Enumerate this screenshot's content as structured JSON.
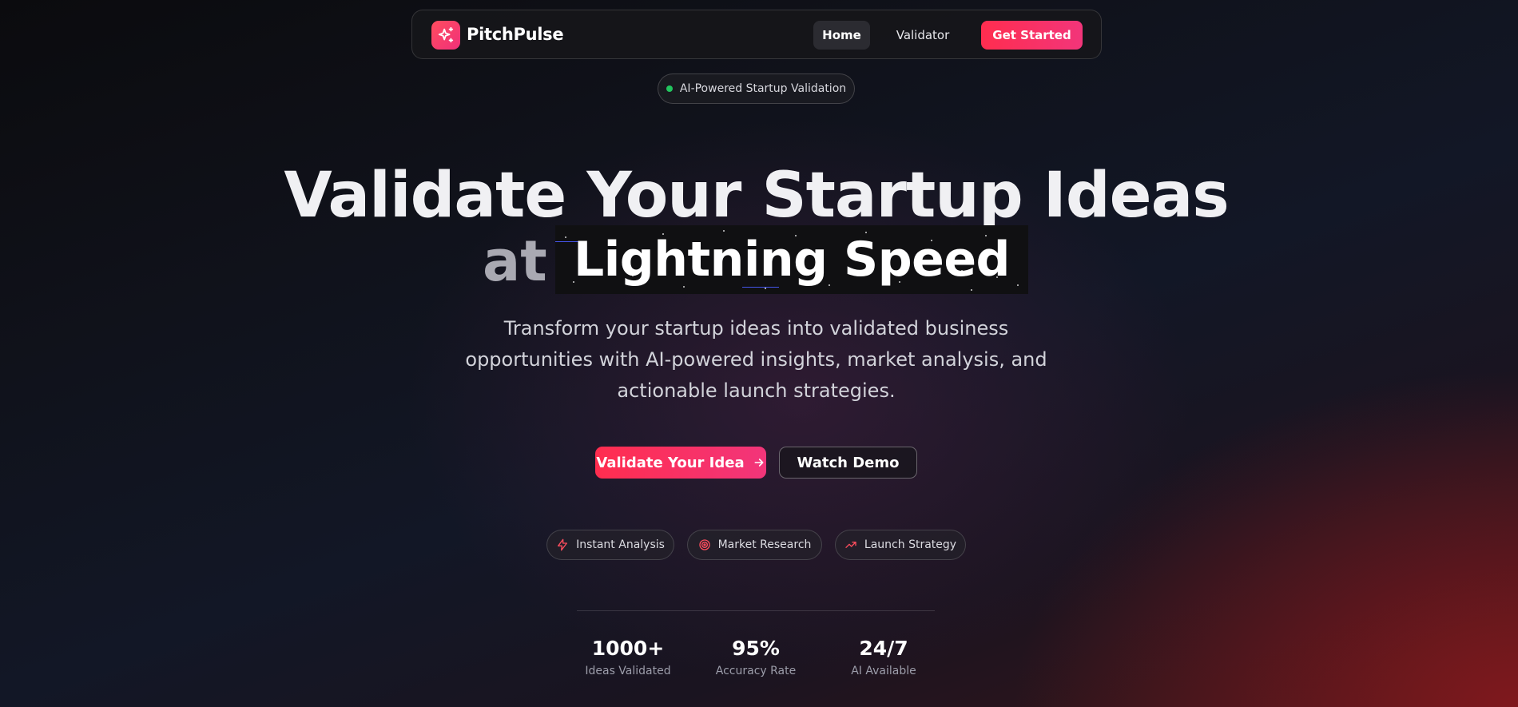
{
  "nav": {
    "brand": "PitchPulse",
    "links": [
      {
        "label": "Home",
        "active": true
      },
      {
        "label": "Validator",
        "active": false
      }
    ],
    "cta_label": "Get Started"
  },
  "badge": {
    "label": "AI-Powered Startup Validation",
    "dot_color": "#22c55e"
  },
  "hero": {
    "title_line1": "Validate Your Startup Ideas",
    "title_at": "at",
    "title_highlight": "Lightning Speed",
    "subtitle": "Transform your startup ideas into validated business opportunities with AI-powered insights, market analysis, and actionable launch strategies."
  },
  "actions": {
    "primary_label": "Validate Your Idea",
    "secondary_label": "Watch Demo"
  },
  "features": [
    {
      "label": "Instant Analysis",
      "icon": "zap-icon"
    },
    {
      "label": "Market Research",
      "icon": "target-icon"
    },
    {
      "label": "Launch Strategy",
      "icon": "trending-up-icon"
    }
  ],
  "stats": [
    {
      "value": "1000+",
      "label": "Ideas Validated"
    },
    {
      "value": "95%",
      "label": "Accuracy Rate"
    },
    {
      "value": "24/7",
      "label": "AI Available"
    }
  ],
  "colors": {
    "accent": "#ff2d4f",
    "accent_end": "#f2357a",
    "icon_accent": "#ff4d5e"
  }
}
